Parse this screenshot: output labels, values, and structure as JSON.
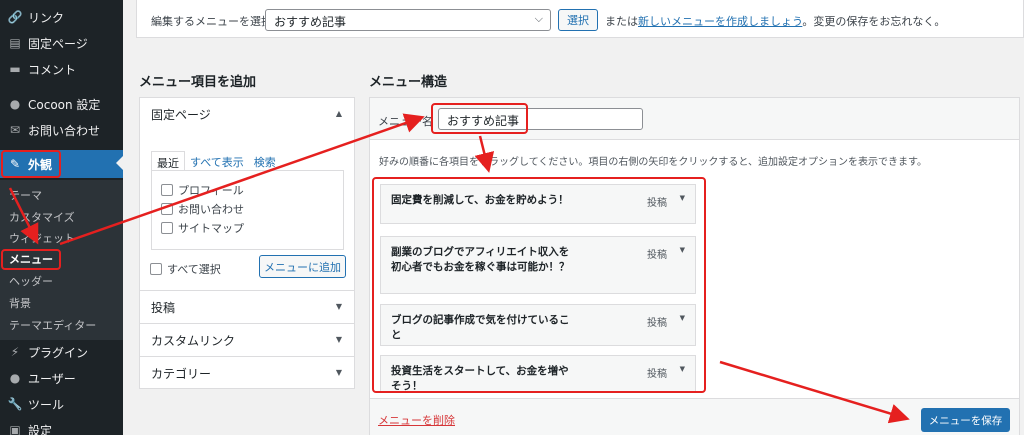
{
  "sidebar": {
    "items": [
      {
        "label": "リンク",
        "icon": "link-icon",
        "glyph": "🔗"
      },
      {
        "label": "固定ページ",
        "icon": "page-icon",
        "glyph": "▤"
      },
      {
        "label": "コメント",
        "icon": "comment-icon",
        "glyph": "▬"
      },
      {
        "label": "Cocoon 設定",
        "icon": "cocoon-icon",
        "glyph": "●"
      },
      {
        "label": "お問い合わせ",
        "icon": "mail-icon",
        "glyph": "✉"
      },
      {
        "label": "外観",
        "icon": "appearance-icon",
        "glyph": "✎"
      },
      {
        "label": "プラグイン",
        "icon": "plugin-icon",
        "glyph": "⚡"
      },
      {
        "label": "ユーザー",
        "icon": "user-icon",
        "glyph": "●"
      },
      {
        "label": "ツール",
        "icon": "tool-icon",
        "glyph": "🔧"
      },
      {
        "label": "設定",
        "icon": "settings-icon",
        "glyph": "▣"
      }
    ],
    "submenu": [
      "テーマ",
      "カスタマイズ",
      "ウィジェット",
      "メニュー",
      "ヘッダー",
      "背景",
      "テーマエディター"
    ]
  },
  "topbar": {
    "select_label": "編集するメニューを選択:",
    "selected": "おすすめ記事",
    "select_button": "選択",
    "or_prefix": "または",
    "create_link": "新しいメニューを作成しましょう",
    "suffix": "。変更の保存をお忘れなく。"
  },
  "left": {
    "heading": "メニュー項目を追加",
    "fixed_pages": "固定ページ",
    "tabs": [
      "最近",
      "すべて表示",
      "検索"
    ],
    "pages": [
      "プロフィール",
      "お問い合わせ",
      "サイトマップ"
    ],
    "select_all": "すべて選択",
    "add_button": "メニューに追加",
    "sections": [
      "投稿",
      "カスタムリンク",
      "カテゴリー"
    ]
  },
  "right": {
    "heading": "メニュー構造",
    "name_label": "メニュー名",
    "name_value": "おすすめ記事",
    "instructions": "好みの順番に各項目をドラッグしてください。項目の右側の矢印をクリックすると、追加設定オプションを表示できます。",
    "items": [
      {
        "title": "固定費を削減して、お金を貯めよう！",
        "type": "投稿"
      },
      {
        "title": "副業のブログでアフィリエイト収入を初心者でもお金を稼ぐ事は可能か！？",
        "type": "投稿"
      },
      {
        "title": "ブログの記事作成で気を付けていること",
        "type": "投稿"
      },
      {
        "title": "投資生活をスタートして、お金を増やそう！",
        "type": "投稿"
      }
    ],
    "delete_link": "メニューを削除",
    "save_button": "メニューを保存"
  },
  "colors": {
    "accent": "#2271b1",
    "annotation": "#e5201f",
    "sidebar": "#1d2327"
  }
}
